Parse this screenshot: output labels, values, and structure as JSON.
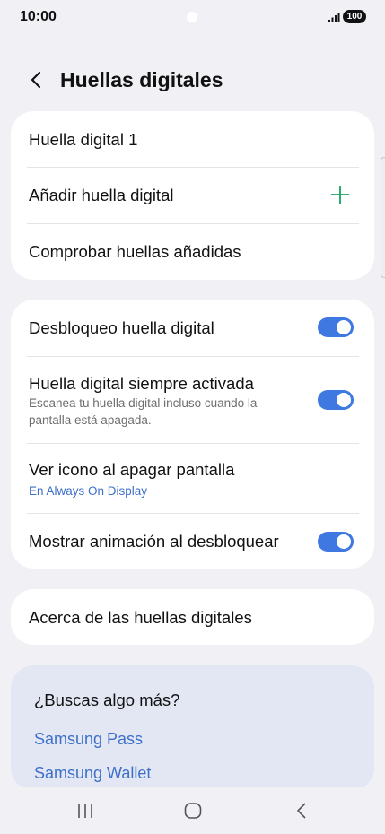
{
  "status_bar": {
    "time": "10:00",
    "battery": "100",
    "signal_icon": "signal-bars-icon"
  },
  "header": {
    "title": "Huellas digitales",
    "back_icon": "chevron-left-icon"
  },
  "fingerprints_card": {
    "items": [
      {
        "label": "Huella digital 1"
      },
      {
        "label": "Añadir huella digital",
        "icon": "plus-icon",
        "icon_color": "#1aa260"
      },
      {
        "label": "Comprobar huellas añadidas"
      }
    ]
  },
  "settings_card": {
    "items": [
      {
        "label": "Desbloqueo huella digital",
        "toggle": true
      },
      {
        "label": "Huella digital siempre activada",
        "sub": "Escanea tu huella digital incluso cuando la pantalla está apagada.",
        "toggle": true
      },
      {
        "label": "Ver icono al apagar pantalla",
        "sub": "En Always On Display"
      },
      {
        "label": "Mostrar animación al desbloquear",
        "toggle": true
      }
    ]
  },
  "about_card": {
    "label": "Acerca de las huellas digitales"
  },
  "suggestions": {
    "title": "¿Buscas algo más?",
    "links": [
      "Samsung Pass",
      "Samsung Wallet"
    ]
  },
  "nav_bar": {
    "recents_icon": "recents-icon",
    "home_icon": "home-icon",
    "back_icon": "back-icon"
  },
  "colors": {
    "accent": "#3e78e0",
    "link": "#3d6fc9",
    "background": "#f1f1f5",
    "plus": "#1aa260"
  }
}
